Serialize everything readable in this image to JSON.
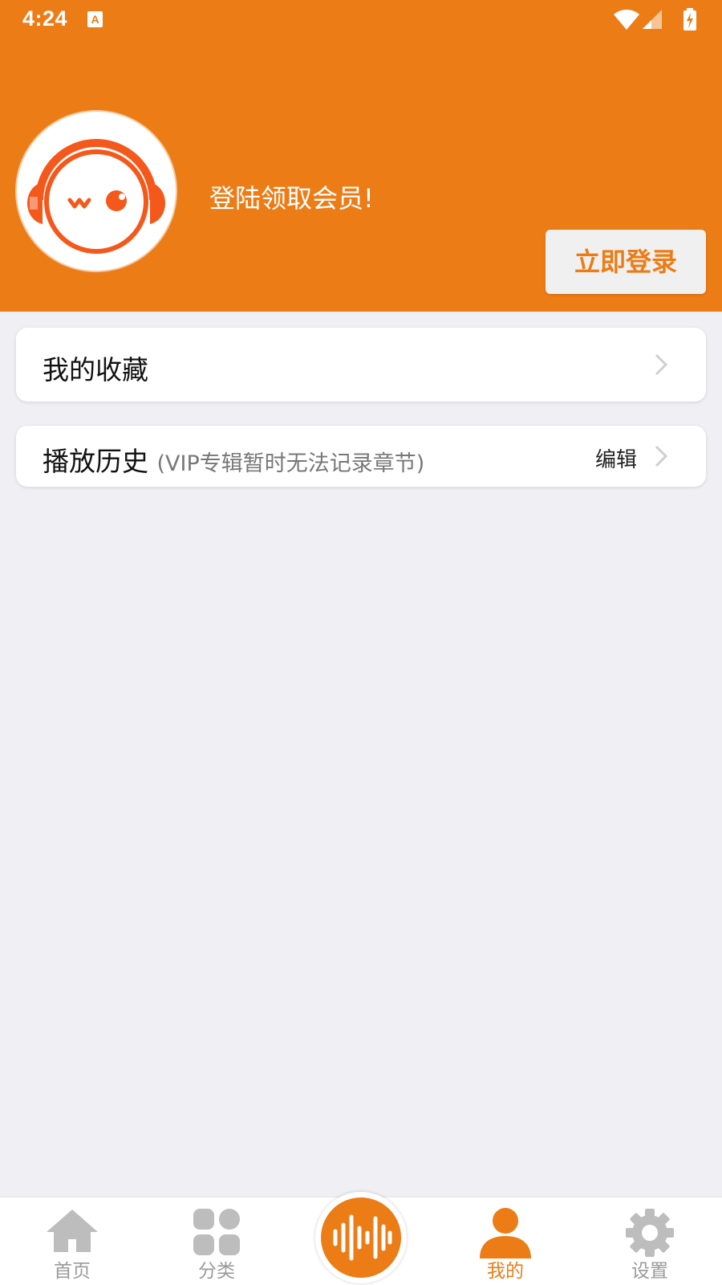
{
  "status_bar": {
    "time": "4:24",
    "notification_icon": "A"
  },
  "header": {
    "avatar": "headphones-mascot-logo",
    "login_hint": "登陆领取会员!",
    "login_button": "立即登录"
  },
  "menu": {
    "favorites": {
      "title": "我的收藏"
    },
    "history": {
      "title": "播放历史",
      "note": "(VIP专辑暂时无法记录章节)",
      "edit": "编辑"
    }
  },
  "tabbar": {
    "items": [
      {
        "label": "首页",
        "icon": "home-icon"
      },
      {
        "label": "分类",
        "icon": "category-icon"
      },
      {
        "label": "",
        "icon": "audio-wave-icon"
      },
      {
        "label": "我的",
        "icon": "person-icon",
        "active": true
      },
      {
        "label": "设置",
        "icon": "gear-icon"
      }
    ]
  },
  "colors": {
    "accent": "#ec7c16",
    "avatar_orange": "#f4581a",
    "inactive": "#bdbdbd",
    "background": "#efeff4"
  }
}
